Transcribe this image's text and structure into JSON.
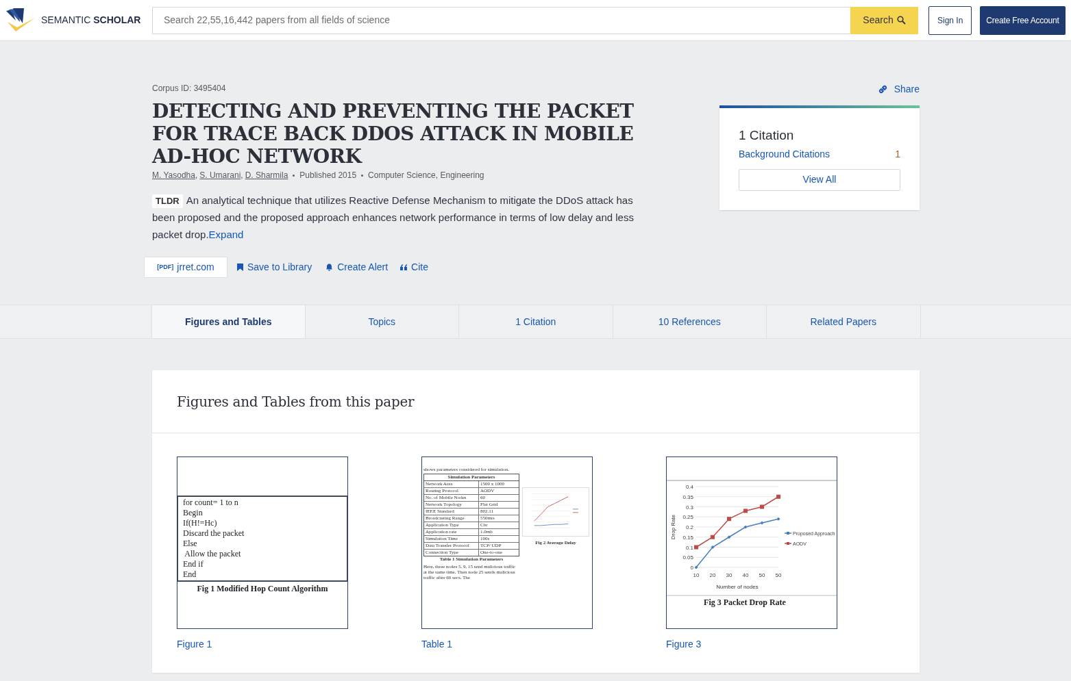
{
  "header": {
    "logo_light": "SEMANTIC",
    "logo_bold": "SCHOLAR",
    "search_placeholder": "Search 22,55,16,442 papers from all fields of science",
    "search_button": "Search",
    "sign_in": "Sign In",
    "create_account": "Create Free Account"
  },
  "paper": {
    "corpus_id": "Corpus ID: 3495404",
    "title": "DETECTING AND PREVENTING THE PACKET FOR TRACE BACK DDOS ATTACK IN MOBILE AD-HOC NETWORK",
    "authors": [
      {
        "name": "M. Yasodha",
        "suffix": ","
      },
      {
        "name": "S. Umarani",
        "suffix": ","
      },
      {
        "name": "D. Sharmila"
      }
    ],
    "published": "Published 2015",
    "fields": "Computer Science, Engineering",
    "tldr_label": "TLDR",
    "tldr": "An analytical technique that utilizes Reactive Defense Mechanism to mitigate the DDoS attack has been proposed and the proposed approach enhances network performance in terms of low delay and less packet drop.",
    "expand": "Expand",
    "pdf_tag": "[PDF]",
    "pdf_source": "jrret.com",
    "save": "Save to Library",
    "alert": "Create Alert",
    "cite": "Cite",
    "share": "Share"
  },
  "citation_card": {
    "title": "1 Citation",
    "rows": [
      {
        "label": "Background Citations",
        "count": "1"
      }
    ],
    "view_all": "View All"
  },
  "tabs": [
    {
      "label": "Figures and Tables",
      "selected": true
    },
    {
      "label": "Topics",
      "selected": false
    },
    {
      "label": "1 Citation",
      "selected": false
    },
    {
      "label": "10 References",
      "selected": false
    },
    {
      "label": "Related Papers",
      "selected": false
    }
  ],
  "figures_section": {
    "heading": "Figures and Tables from this paper",
    "figures": [
      {
        "kind": "algorithm",
        "label": "Figure 1",
        "lines": [
          "for count= 1 to n",
          "Begin",
          "If(H!=Hc)",
          "Discard the packet",
          "Else",
          " Allow the packet",
          "End if",
          "End"
        ],
        "caption": "Fig 1 Modified Hop Count Algorithm"
      },
      {
        "kind": "table",
        "label": "Table 1",
        "intro": "shows parameters considered for simulation.",
        "table_title": "Simulation Parameters",
        "rows": [
          [
            "Network Area",
            "1500 x 1000"
          ],
          [
            "Routing Protocol",
            "AODV"
          ],
          [
            "No. of Mobile Nodes",
            "60"
          ],
          [
            "Network Topology",
            "Flat Grid"
          ],
          [
            "IEEE Standard",
            "802.11"
          ],
          [
            "Broadcasting Range",
            "550mts"
          ],
          [
            "Application Type",
            "Cbr"
          ],
          [
            "Application rate",
            "1.0mb"
          ],
          [
            "Simulation Time",
            "100s"
          ],
          [
            "Data Transfer Protocol",
            "TCP/ UDP"
          ],
          [
            "Connection Type",
            "One-to-one"
          ]
        ],
        "caption": "Table 1 Simulation Parameters",
        "body": "Here, three nodes 5, 9, 15 send malicious traffic at the same time. Then node 25 sends malicious traffic after 60 secs. The",
        "side_caption": "Fig 2 Average Delay"
      },
      {
        "kind": "chart",
        "label": "Figure 3",
        "caption": "Fig 3 Packet Drop Rate",
        "chart_data": {
          "type": "line",
          "xlabel": "Number of nodes",
          "ylabel": "Drop Rate",
          "categories": [
            "10",
            "20",
            "30",
            "40",
            "50",
            "50"
          ],
          "grid": true,
          "legend": true,
          "series": [
            {
              "name": "Proposed Approach",
              "color": "#4a7ebb",
              "marker": "diamond",
              "values": [
                0,
                0.1,
                0.15,
                0.2,
                0.22,
                0.24
              ]
            },
            {
              "name": "AODV",
              "color": "#be4b48",
              "marker": "square",
              "values": [
                0.1,
                0.15,
                0.24,
                0.28,
                0.3,
                0.35
              ]
            }
          ],
          "ylim": [
            0,
            0.4
          ],
          "yticks": [
            {
              "value": 0,
              "label": "0"
            },
            {
              "value": 0.05,
              "label": "0.05"
            },
            {
              "value": 0.1,
              "label": "0.1"
            },
            {
              "value": 0.15,
              "label": "0.15"
            },
            {
              "value": 0.2,
              "label": "0.2"
            },
            {
              "value": 0.25,
              "label": "0.25"
            },
            {
              "value": 0.3,
              "label": "0.3"
            },
            {
              "value": 0.35,
              "label": "0.35"
            },
            {
              "value": 0.4,
              "label": "0.4"
            }
          ]
        }
      }
    ]
  }
}
